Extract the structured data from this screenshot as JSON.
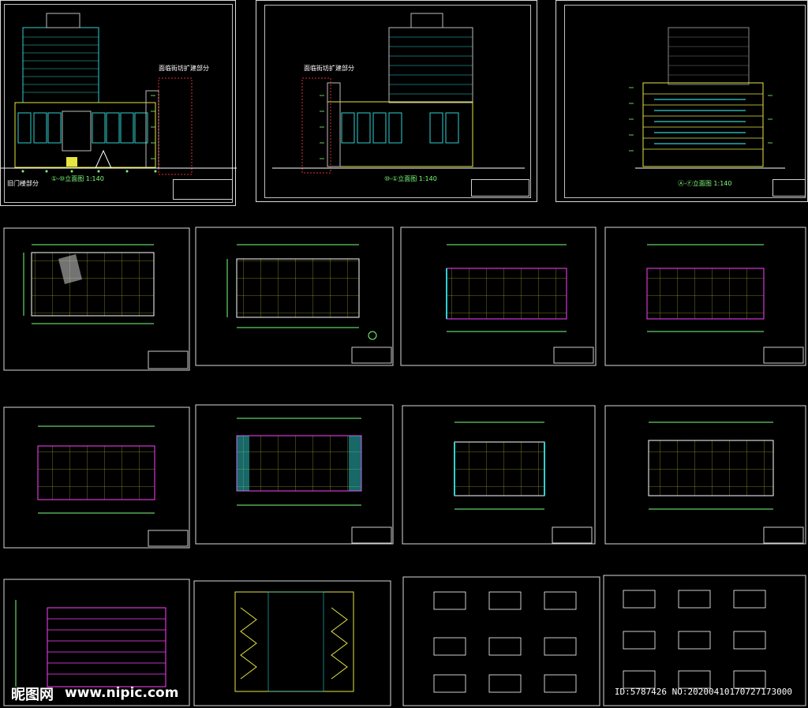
{
  "sheets": {
    "elev1": {
      "title": "①-⑩立面图 1:140",
      "note": "面临街坊扩建部分",
      "note2": "旧门楼部分"
    },
    "elev2": {
      "title": "⑩-①立面图 1:140",
      "note": "面临街坊扩建部分"
    },
    "elev3": {
      "title": "Ⓐ-Ⓕ立面图 1:140"
    }
  },
  "watermark": {
    "logo": "昵图网",
    "url": "www.nipic.com",
    "id": "ID:5787426 NO:20200410170727173000"
  }
}
